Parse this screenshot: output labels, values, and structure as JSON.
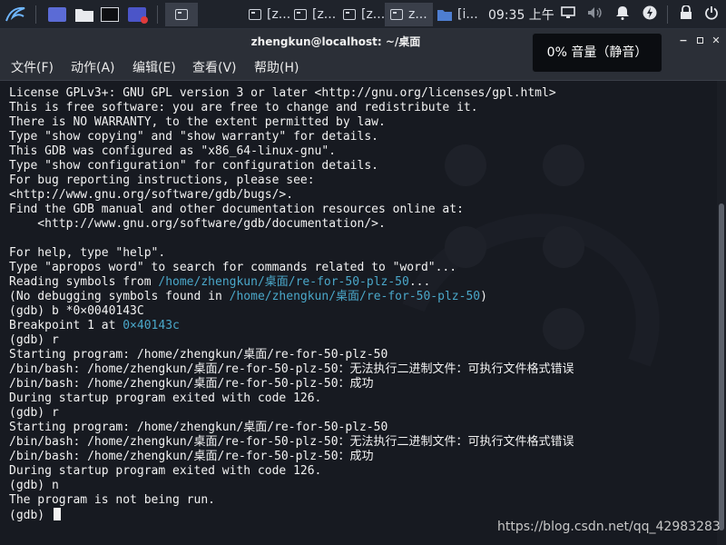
{
  "taskbar": {
    "tasks": [
      {
        "label": "[z..."
      },
      {
        "label": "[z..."
      },
      {
        "label": "[z..."
      },
      {
        "label": "z..."
      },
      {
        "label": "[i..."
      }
    ],
    "clock": "09:35 上午"
  },
  "window": {
    "title": "zhengkun@localhost: ~/桌面",
    "menu": [
      "文件(F)",
      "动作(A)",
      "编辑(E)",
      "查看(V)",
      "帮助(H)"
    ]
  },
  "osd": {
    "text": "0% 音量（静音）"
  },
  "terminal": {
    "lines": [
      [
        {
          "t": "License GPLv3+: GNU GPL version 3 or later <http://gnu.org/licenses/gpl.html>"
        }
      ],
      [
        {
          "t": "This is free software: you are free to change and redistribute it."
        }
      ],
      [
        {
          "t": "There is NO WARRANTY, to the extent permitted by law."
        }
      ],
      [
        {
          "t": "Type \"show copying\" and \"show warranty\" for details."
        }
      ],
      [
        {
          "t": "This GDB was configured as \"x86_64-linux-gnu\"."
        }
      ],
      [
        {
          "t": "Type \"show configuration\" for configuration details."
        }
      ],
      [
        {
          "t": "For bug reporting instructions, please see:"
        }
      ],
      [
        {
          "t": "<http://www.gnu.org/software/gdb/bugs/>."
        }
      ],
      [
        {
          "t": "Find the GDB manual and other documentation resources online at:"
        }
      ],
      [
        {
          "t": "    <http://www.gnu.org/software/gdb/documentation/>."
        }
      ],
      [
        {
          "t": ""
        }
      ],
      [
        {
          "t": "For help, type \"help\"."
        }
      ],
      [
        {
          "t": "Type \"apropos word\" to search for commands related to \"word\"..."
        }
      ],
      [
        {
          "t": "Reading symbols from "
        },
        {
          "t": "/home/zhengkun/桌面/re-for-50-plz-50",
          "c": "path"
        },
        {
          "t": "..."
        }
      ],
      [
        {
          "t": "(No debugging symbols found in "
        },
        {
          "t": "/home/zhengkun/桌面/re-for-50-plz-50",
          "c": "path"
        },
        {
          "t": ")"
        }
      ],
      [
        {
          "t": "(gdb) b *0×0040143C"
        }
      ],
      [
        {
          "t": "Breakpoint 1 at "
        },
        {
          "t": "0×40143c",
          "c": "path"
        }
      ],
      [
        {
          "t": "(gdb) r"
        }
      ],
      [
        {
          "t": "Starting program: /home/zhengkun/桌面/re-for-50-plz-50"
        }
      ],
      [
        {
          "t": "/bin/bash: /home/zhengkun/桌面/re-for-50-plz-50：无法执行二进制文件：可执行文件格式错误"
        }
      ],
      [
        {
          "t": "/bin/bash: /home/zhengkun/桌面/re-for-50-plz-50：成功"
        }
      ],
      [
        {
          "t": "During startup program exited with code 126."
        }
      ],
      [
        {
          "t": "(gdb) r"
        }
      ],
      [
        {
          "t": "Starting program: /home/zhengkun/桌面/re-for-50-plz-50"
        }
      ],
      [
        {
          "t": "/bin/bash: /home/zhengkun/桌面/re-for-50-plz-50：无法执行二进制文件：可执行文件格式错误"
        }
      ],
      [
        {
          "t": "/bin/bash: /home/zhengkun/桌面/re-for-50-plz-50：成功"
        }
      ],
      [
        {
          "t": "During startup program exited with code 126."
        }
      ],
      [
        {
          "t": "(gdb) n"
        }
      ],
      [
        {
          "t": "The program is not being run."
        }
      ],
      [
        {
          "t": "(gdb) "
        }
      ]
    ]
  },
  "watermark": "https://blog.csdn.net/qq_42983283"
}
